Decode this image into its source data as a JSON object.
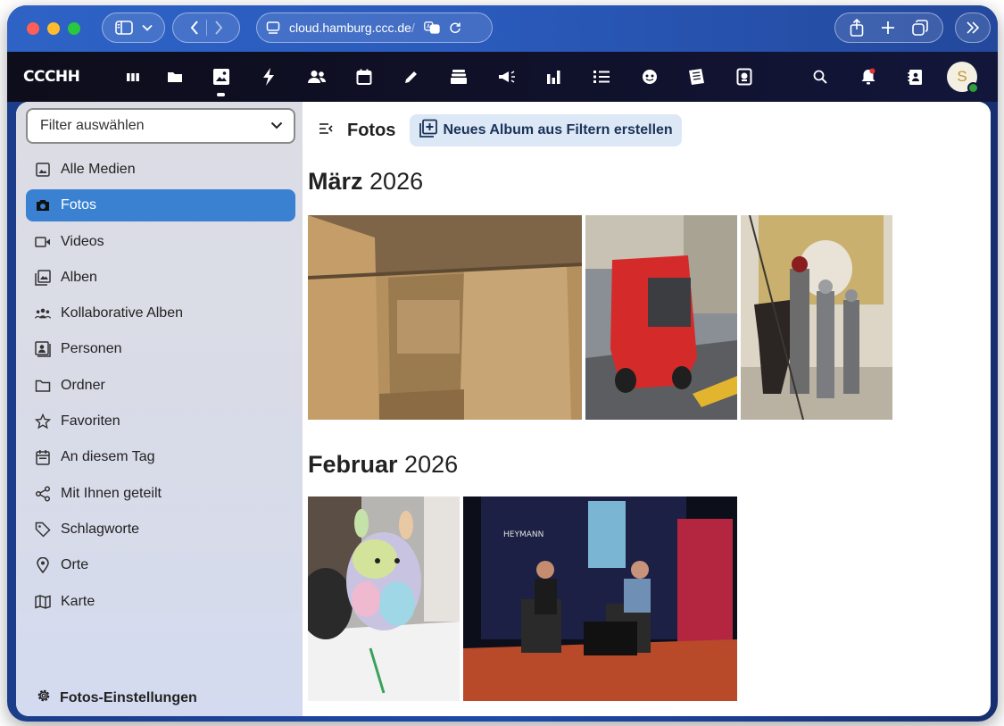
{
  "browser": {
    "url_main": "cloud.hamburg.ccc.de",
    "url_tail": "/"
  },
  "header": {
    "logo_text": "CCCHH",
    "apps": [
      "dashboard-icon",
      "files-icon",
      "photos-icon",
      "activity-icon",
      "contacts-icon",
      "calendar-icon",
      "notes-icon",
      "deck-icon",
      "announcements-icon",
      "analytics-icon",
      "tasks-icon",
      "face-icon",
      "forms-icon",
      "cookbook-icon"
    ],
    "avatar_letter": "S"
  },
  "sidebar": {
    "filter_placeholder": "Filter auswählen",
    "items": [
      {
        "label": "Alle Medien",
        "icon": "image-icon"
      },
      {
        "label": "Fotos",
        "icon": "camera-icon"
      },
      {
        "label": "Videos",
        "icon": "video-icon"
      },
      {
        "label": "Alben",
        "icon": "album-icon"
      },
      {
        "label": "Kollaborative Alben",
        "icon": "people-icon"
      },
      {
        "label": "Personen",
        "icon": "person-icon"
      },
      {
        "label": "Ordner",
        "icon": "folder-icon"
      },
      {
        "label": "Favoriten",
        "icon": "star-icon"
      },
      {
        "label": "An diesem Tag",
        "icon": "calendar-icon"
      },
      {
        "label": "Mit Ihnen geteilt",
        "icon": "share-icon"
      },
      {
        "label": "Schlagworte",
        "icon": "tag-icon"
      },
      {
        "label": "Orte",
        "icon": "location-icon"
      },
      {
        "label": "Karte",
        "icon": "map-icon"
      }
    ],
    "active_index": 1,
    "settings_label": "Fotos-Einstellungen"
  },
  "main": {
    "title": "Fotos",
    "new_album_label": "Neues Album aus Filtern erstellen",
    "sections": [
      {
        "month": "März",
        "year": "2026"
      },
      {
        "month": "Februar",
        "year": "2026"
      }
    ]
  },
  "colors": {
    "accent": "#3a81d2",
    "header_bg": "#0e0d1b",
    "browser_bar": "#2e62c5"
  }
}
